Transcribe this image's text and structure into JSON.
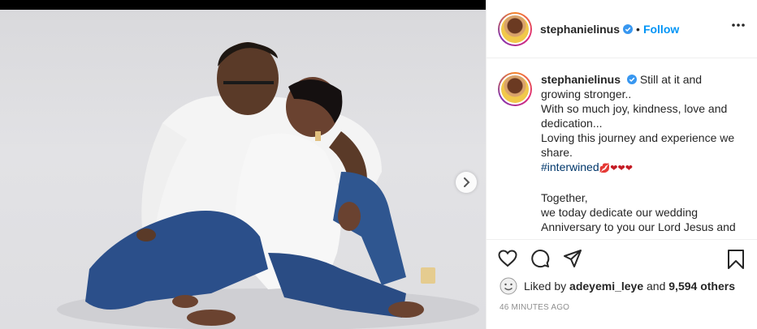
{
  "header": {
    "username": "stephanielinus",
    "separator": "•",
    "follow_label": "Follow",
    "more_icon": "more-options-icon"
  },
  "caption": {
    "username": "stephanielinus",
    "lines": [
      "Still at it and",
      "growing stronger..",
      "With so much joy, kindness, love and",
      "dedication...",
      "Loving this journey and experience we",
      "share."
    ],
    "hashtag": "#interwined",
    "emojis": "💋❤❤❤",
    "lines2": [
      "Together,",
      "we today dedicate our wedding",
      "Anniversary to you our Lord Jesus and"
    ]
  },
  "actions": {
    "like_icon": "heart-icon",
    "comment_icon": "comment-icon",
    "share_icon": "share-icon",
    "save_icon": "bookmark-icon"
  },
  "likes": {
    "prefix": "Liked by",
    "user": "adeyemi_leye",
    "conj": "and",
    "others": "9,594 others"
  },
  "timestamp": "46 MINUTES AGO",
  "colors": {
    "accent": "#0095f6",
    "hashtag": "#00376b",
    "muted": "#8e8e8e"
  }
}
